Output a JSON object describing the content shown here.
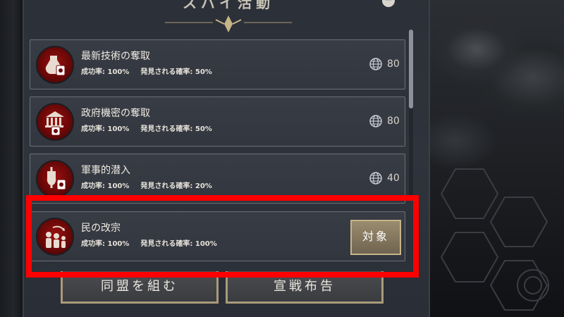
{
  "panel": {
    "title": "スパイ活動",
    "minimize_label": "−"
  },
  "actions": [
    {
      "name": "最新技術の奪取",
      "success_label": "成功率: 100%",
      "detect_label": "発見される確率: 50%",
      "cost": "80",
      "icon": "flask-icon"
    },
    {
      "name": "政府機密の奪取",
      "success_label": "成功率: 100%",
      "detect_label": "発見される確率: 50%",
      "cost": "80",
      "icon": "government-building-icon"
    },
    {
      "name": "軍事的潜入",
      "success_label": "成功率: 100%",
      "detect_label": "発見される確率: 20%",
      "cost": "40",
      "icon": "sword-shield-icon"
    },
    {
      "name": "民の改宗",
      "success_label": "成功率: 100%",
      "detect_label": "発見される確率: 100%",
      "target_label": "対象",
      "icon": "people-convert-icon"
    }
  ],
  "buttons": {
    "alliance": "同盟を組む",
    "declare_war": "宣戦布告"
  },
  "colors": {
    "highlight": "#ff0000",
    "icon_red": "#9b1010",
    "accent_gold": "#c7b58a"
  }
}
